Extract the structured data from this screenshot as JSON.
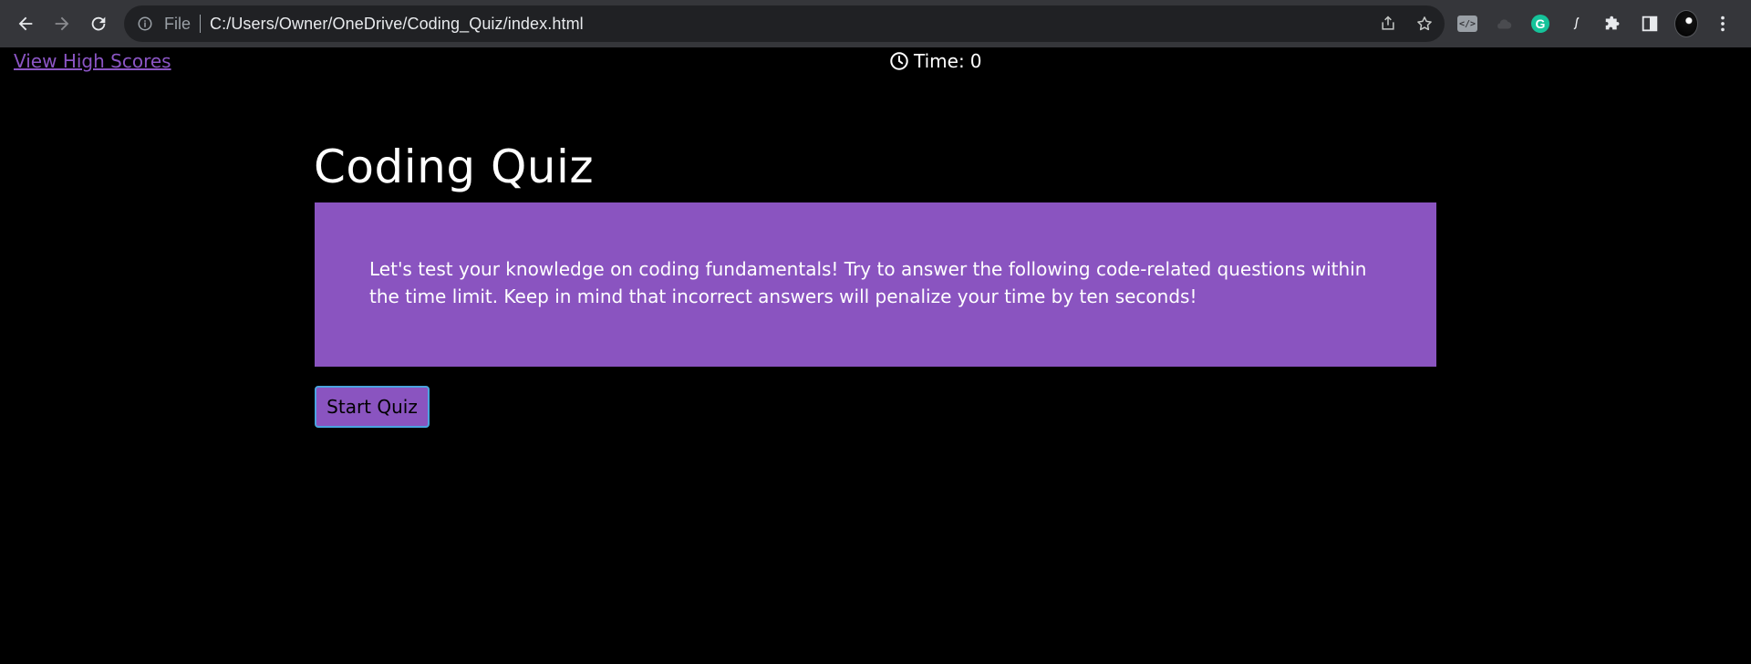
{
  "browser": {
    "info_label": "File",
    "url": "C:/Users/Owner/OneDrive/Coding_Quiz/index.html",
    "extensions": {
      "code_ext_label": "</>",
      "grammarly_label": "G"
    }
  },
  "header": {
    "high_scores_link": "View High Scores",
    "timer_label": "Time:",
    "timer_value": "0"
  },
  "main": {
    "title": "Coding Quiz",
    "intro": "Let's test your knowledge on coding fundamentals! Try to answer the following code-related questions within the time limit. Keep in mind that incorrect answers will penalize your time by ten seconds!",
    "start_button": "Start Quiz"
  },
  "colors": {
    "accent_purple": "#8a54c0",
    "link_purple": "#8b55c4",
    "button_border": "#4aa3df",
    "page_background": "#000000"
  },
  "icons": [
    "back-arrow-icon",
    "forward-arrow-icon",
    "reload-icon",
    "info-icon",
    "share-icon",
    "star-icon",
    "puzzle-icon",
    "side-panel-icon",
    "menu-dots-icon",
    "clock-icon"
  ]
}
